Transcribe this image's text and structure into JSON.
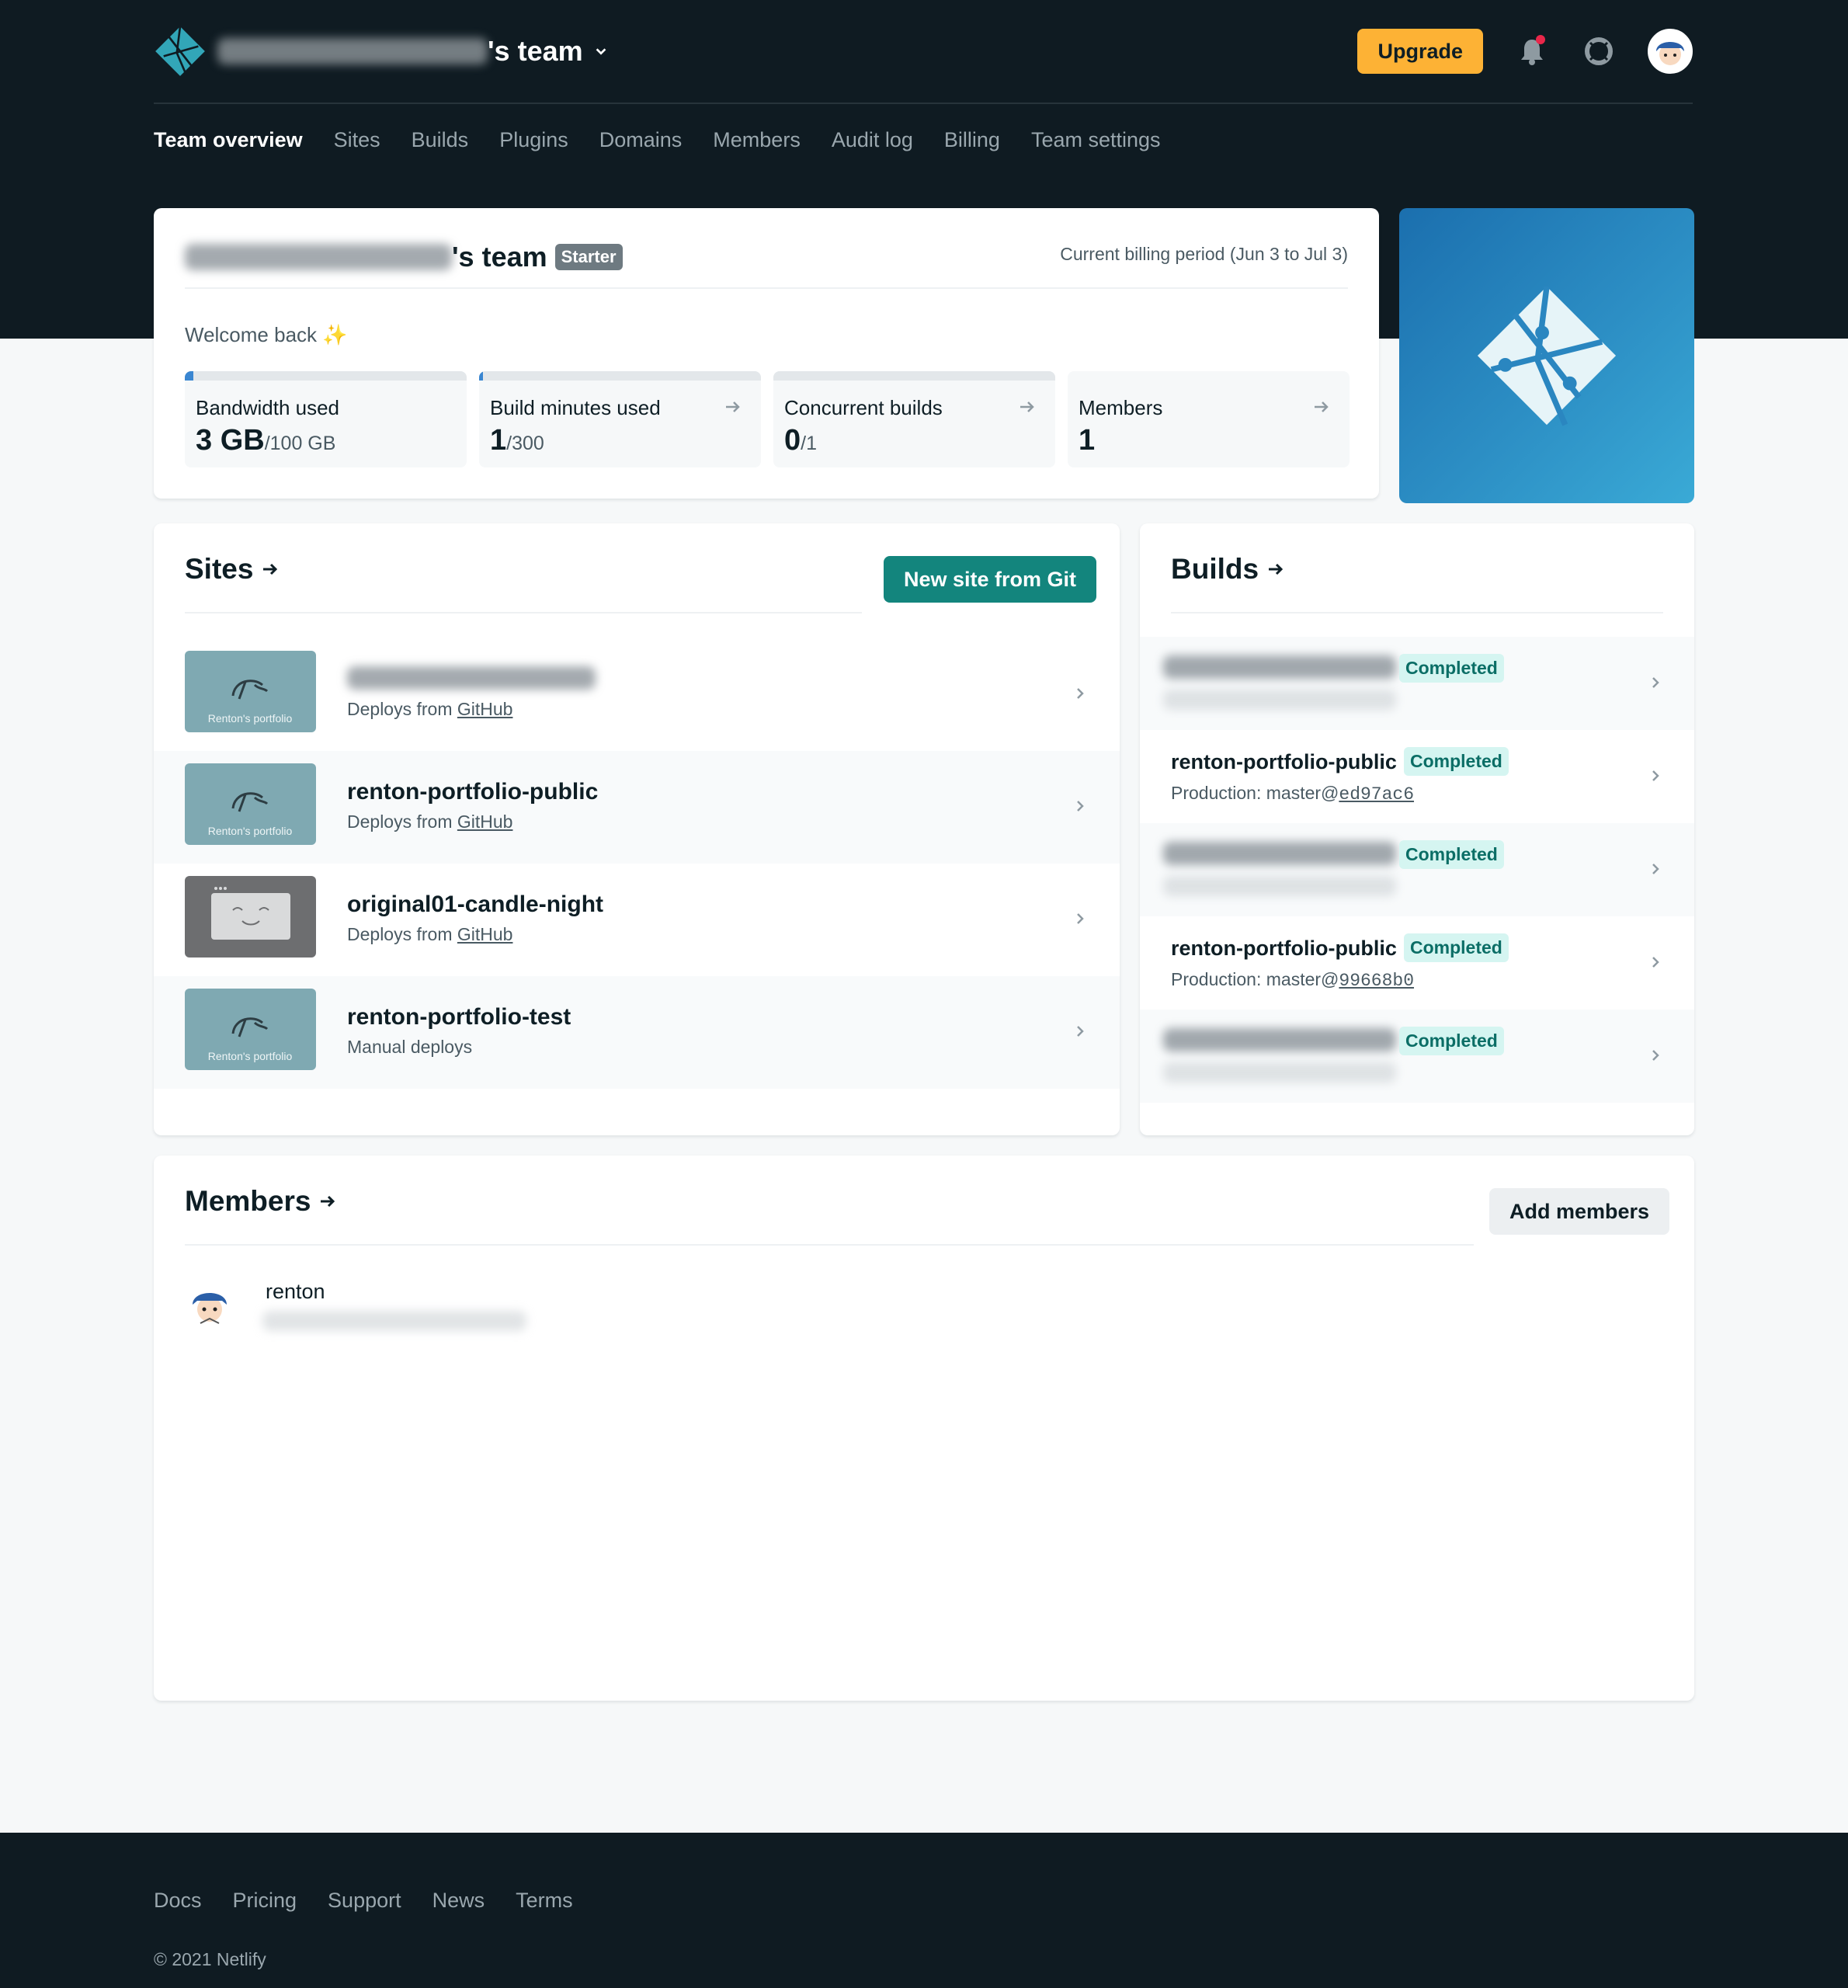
{
  "header": {
    "team_suffix": "'s team",
    "upgrade_label": "Upgrade"
  },
  "nav": {
    "items": [
      "Team overview",
      "Sites",
      "Builds",
      "Plugins",
      "Domains",
      "Members",
      "Audit log",
      "Billing",
      "Team settings"
    ],
    "active": "Team overview"
  },
  "overview": {
    "team_suffix": "'s team",
    "plan_badge": "Starter",
    "billing_period": "Current billing period (Jun 3 to Jul 3)",
    "welcome": "Welcome back",
    "welcome_emoji": "✨",
    "stats": [
      {
        "label": "Bandwidth used",
        "value": "3 GB",
        "limit": "/100 GB",
        "progress": 0.03
      },
      {
        "label": "Build minutes used",
        "value": "1",
        "limit": "/300",
        "progress": 0.0033
      },
      {
        "label": "Concurrent builds",
        "value": "0",
        "limit": "/1",
        "progress": 0
      },
      {
        "label": "Members",
        "value": "1",
        "limit": ""
      }
    ]
  },
  "sites": {
    "title": "Sites",
    "new_site_label": "New site from Git",
    "items": [
      {
        "name": "",
        "deploy_prefix": "Deploys from ",
        "deploy_link": "GitHub",
        "thumb": "teal",
        "thumb_text": "Renton's portfolio"
      },
      {
        "name": "renton-portfolio-public",
        "deploy_prefix": "Deploys from ",
        "deploy_link": "GitHub",
        "thumb": "teal",
        "thumb_text": "Renton's portfolio"
      },
      {
        "name": "original01-candle-night",
        "deploy_prefix": "Deploys from ",
        "deploy_link": "GitHub",
        "thumb": "grey",
        "thumb_text": ""
      },
      {
        "name": "renton-portfolio-test",
        "deploy_prefix": "Manual deploys",
        "deploy_link": "",
        "thumb": "teal",
        "thumb_text": "Renton's portfolio"
      }
    ]
  },
  "builds": {
    "title": "Builds",
    "items": [
      {
        "name": "",
        "status": "Completed",
        "sub_prefix": "",
        "commit": ""
      },
      {
        "name": "renton-portfolio-public",
        "status": "Completed",
        "sub_prefix": "Production: master@",
        "commit": "ed97ac6"
      },
      {
        "name": "",
        "status": "Completed",
        "sub_prefix": "",
        "commit": ""
      },
      {
        "name": "renton-portfolio-public",
        "status": "Completed",
        "sub_prefix": "Production: master@",
        "commit": "99668b0"
      },
      {
        "name": "",
        "status": "Completed",
        "sub_prefix": "",
        "commit": ""
      }
    ]
  },
  "members": {
    "title": "Members",
    "add_label": "Add members",
    "list": [
      {
        "name": "renton"
      }
    ]
  },
  "footer": {
    "links": [
      "Docs",
      "Pricing",
      "Support",
      "News",
      "Terms"
    ],
    "copyright": "© 2021 Netlify"
  },
  "colors": {
    "header_bg": "#0f1b22",
    "upgrade": "#fdb235",
    "teal_button": "#13857d",
    "completed_badge_bg": "#d5f5f1",
    "completed_badge_text": "#0b6e66",
    "notification_dot": "#e9274a"
  },
  "icons": [
    "netlify-logo-icon",
    "chevron-down-icon",
    "bell-icon",
    "lifebuoy-icon",
    "arrow-right-icon",
    "chevron-right-icon"
  ]
}
